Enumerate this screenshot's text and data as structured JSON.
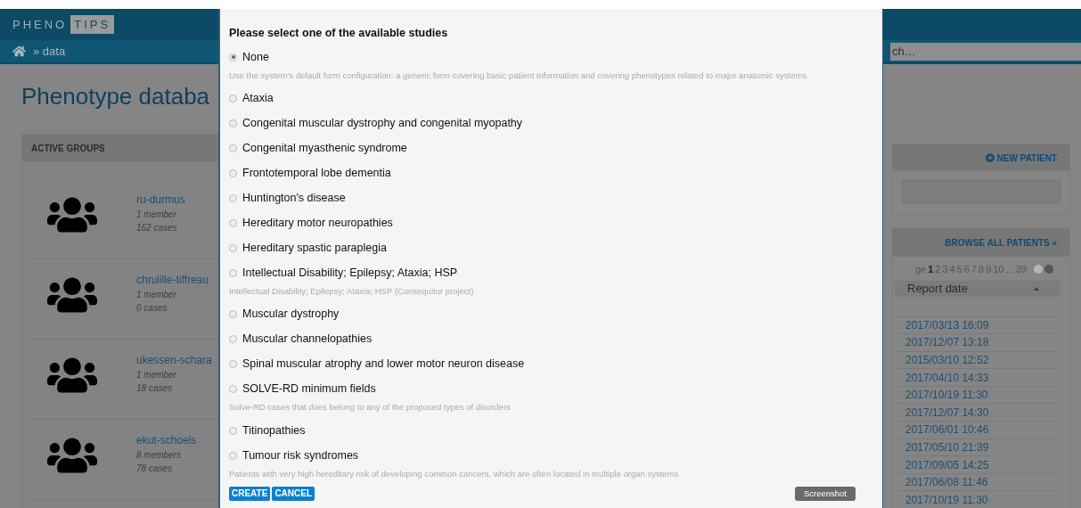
{
  "header": {
    "logo": {
      "left": "PHENO",
      "right": "TIPS"
    },
    "breadcrumb": "» data",
    "search": {
      "placeholder": "ch…"
    }
  },
  "page_title": "Phenotype databa",
  "groups_panel": {
    "title": "ACTIVE GROUPS",
    "groups": [
      {
        "name": "ru-durmus",
        "members": "1 member",
        "cases": "162 cases"
      },
      {
        "name": "chrulille-tiffreau",
        "members": "1 member",
        "cases": "0 cases"
      },
      {
        "name": "ukessen-schara",
        "members": "1 member",
        "cases": "18 cases"
      },
      {
        "name": "ekut-schoels",
        "members": "8 members",
        "cases": "78 cases"
      }
    ]
  },
  "new_patient_panel": {
    "action": "NEW PATIENT"
  },
  "patients_panel": {
    "action": "BROWSE ALL PATIENTS »",
    "pagination": {
      "prefix": "ge",
      "pages": [
        {
          "label": "1",
          "selected": true
        },
        {
          "label": "2",
          "selected": false
        },
        {
          "label": "3",
          "selected": false
        },
        {
          "label": "4",
          "selected": false
        },
        {
          "label": "5",
          "selected": false
        },
        {
          "label": "6",
          "selected": false
        },
        {
          "label": "7",
          "selected": false
        },
        {
          "label": "8",
          "selected": false
        },
        {
          "label": "9",
          "selected": false
        },
        {
          "label": "10",
          "selected": false
        }
      ],
      "ellipsis": "...",
      "last": "39",
      "previous": {
        "disabled": true
      },
      "next": {
        "disabled": false
      }
    },
    "column": "Report date",
    "dates": [
      "2017/03/13 16:09",
      "2017/12/07 13:18",
      "2015/03/10 12:52",
      "2017/04/10 14:33",
      "2017/10/19 11:30",
      "2017/12/07 14:30",
      "2017/06/01 10:46",
      "2017/05/10 21:39",
      "2017/09/05 14:25",
      "2017/06/08 11:46",
      "2017/10/19 11:30"
    ]
  },
  "dialog": {
    "title": "Please select one of the available studies",
    "options": [
      {
        "label": "None",
        "selected": true,
        "description": "Use the system's default form configuration: a generic form covering basic patient information and covering phenotypes related to major anatomic systems."
      },
      {
        "label": "Ataxia",
        "selected": false
      },
      {
        "label": "Congenital muscular dystrophy and congenital myopathy",
        "selected": false
      },
      {
        "label": "Congenital myasthenic syndrome",
        "selected": false
      },
      {
        "label": "Frontotemporal lobe dementia",
        "selected": false
      },
      {
        "label": "Huntington's disease",
        "selected": false
      },
      {
        "label": "Hereditary motor neuropathies",
        "selected": false
      },
      {
        "label": "Hereditary spastic paraplegia",
        "selected": false
      },
      {
        "label": "Intellectual Disability; Epilepsy; Ataxia; HSP",
        "selected": false,
        "description": "Intellectual Disability; Epilepsy; Ataxia; HSP (Consequitur project)"
      },
      {
        "label": "Muscular dystrophy",
        "selected": false
      },
      {
        "label": "Muscular channelopathies",
        "selected": false
      },
      {
        "label": "Spinal muscular atrophy and lower motor neuron disease",
        "selected": false
      },
      {
        "label": "SOLVE-RD minimum fields",
        "selected": false,
        "description": "Solve-RD cases that does belong to any of the proposed types of disorders"
      },
      {
        "label": "Titinopathies",
        "selected": false
      },
      {
        "label": "Tumour risk syndromes",
        "selected": false,
        "description": "Patients with very high hereditary risk of developing common cancers, which are often located in multiple organ systems"
      }
    ],
    "buttons": [
      "CREATE",
      "CANCEL"
    ],
    "screenshot_button": "Screenshot"
  }
}
